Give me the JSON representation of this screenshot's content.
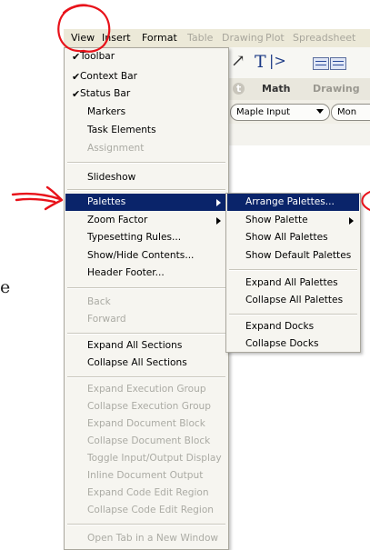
{
  "menubar": {
    "items": [
      {
        "label": "View",
        "enabled": true
      },
      {
        "label": "Insert",
        "enabled": true
      },
      {
        "label": "Format",
        "enabled": true
      },
      {
        "label": "Table",
        "enabled": false
      },
      {
        "label": "Drawing",
        "enabled": false
      },
      {
        "label": "Plot",
        "enabled": false
      },
      {
        "label": "Spreadsheet",
        "enabled": false
      }
    ]
  },
  "toolbar": {
    "mode_tabs": [
      {
        "label": "t",
        "selected": true
      },
      {
        "label": "Math",
        "selected": false
      },
      {
        "label": "Drawing",
        "selected": false
      }
    ],
    "input_mode": "Maple Input",
    "font_combo": "Mon"
  },
  "view_menu": {
    "items": [
      {
        "label": "Toolbar",
        "checked": true,
        "enabled": true
      },
      {
        "label": "Context Bar",
        "checked": true,
        "enabled": true
      },
      {
        "label": "Status Bar",
        "checked": true,
        "enabled": true
      },
      {
        "label": "Markers",
        "checked": false,
        "enabled": true
      },
      {
        "label": "Task Elements",
        "checked": false,
        "enabled": true
      },
      {
        "label": "Assignment",
        "checked": false,
        "enabled": false
      },
      {
        "label": "Slideshow",
        "checked": false,
        "enabled": true
      },
      {
        "label": "Palettes",
        "checked": false,
        "enabled": true,
        "submenu": true,
        "highlighted": true
      },
      {
        "label": "Zoom Factor",
        "checked": false,
        "enabled": true,
        "submenu": true
      },
      {
        "label": "Typesetting Rules...",
        "checked": false,
        "enabled": true
      },
      {
        "label": "Show/Hide Contents...",
        "checked": false,
        "enabled": true
      },
      {
        "label": "Header Footer...",
        "checked": false,
        "enabled": true
      },
      {
        "label": "Back",
        "checked": false,
        "enabled": false
      },
      {
        "label": "Forward",
        "checked": false,
        "enabled": false
      },
      {
        "label": "Expand All Sections",
        "checked": false,
        "enabled": true
      },
      {
        "label": "Collapse All Sections",
        "checked": false,
        "enabled": true
      },
      {
        "label": "Expand Execution Group",
        "checked": false,
        "enabled": false
      },
      {
        "label": "Collapse Execution Group",
        "checked": false,
        "enabled": false
      },
      {
        "label": "Expand Document Block",
        "checked": false,
        "enabled": false
      },
      {
        "label": "Collapse Document Block",
        "checked": false,
        "enabled": false
      },
      {
        "label": "Toggle Input/Output Display",
        "checked": false,
        "enabled": false
      },
      {
        "label": "Inline Document Output",
        "checked": false,
        "enabled": false
      },
      {
        "label": "Expand Code Edit Region",
        "checked": false,
        "enabled": false
      },
      {
        "label": "Collapse Code Edit Region",
        "checked": false,
        "enabled": false
      },
      {
        "label": "Open Tab in a New Window",
        "checked": false,
        "enabled": false
      }
    ]
  },
  "palettes_submenu": {
    "items": [
      {
        "label": "Arrange Palettes...",
        "highlighted": true
      },
      {
        "label": "Show Palette",
        "submenu": true
      },
      {
        "label": "Show All Palettes"
      },
      {
        "label": "Show Default Palettes"
      },
      {
        "label": "Expand All Palettes"
      },
      {
        "label": "Collapse All Palettes"
      },
      {
        "label": "Expand Docks"
      },
      {
        "label": "Collapse Docks"
      }
    ]
  },
  "background_text": "e",
  "colors": {
    "highlight": "#0a246a",
    "annotation": "#e8121a",
    "menu_bg": "#f6f5f0",
    "disabled_text": "#ababa4"
  }
}
